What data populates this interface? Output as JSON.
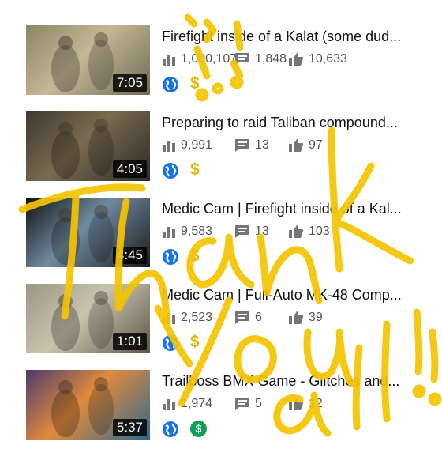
{
  "videos": [
    {
      "title": "Firefight inside of a Kalat (some dud...",
      "duration": "7:05",
      "views": "1,000,107",
      "comments": "1,848",
      "likes": "10,633",
      "monetization": "yellow",
      "thumb_colors": [
        "#8a8566",
        "#c4b896",
        "#6e6b55"
      ]
    },
    {
      "title": "Preparing to raid Taliban compound...",
      "duration": "4:05",
      "views": "9,991",
      "comments": "13",
      "likes": "97",
      "monetization": "yellow",
      "thumb_colors": [
        "#3c3a30",
        "#7a6a50",
        "#2a2a26"
      ]
    },
    {
      "title": "Medic Cam | Firefight inside of a Kal...",
      "duration": "4:45",
      "views": "9,583",
      "comments": "13",
      "likes": "103",
      "monetization": "yellow",
      "thumb_colors": [
        "#111111",
        "#6f8aa0",
        "#1a1a1a"
      ]
    },
    {
      "title": "Medic Cam | Full-Auto MK-48 Comp...",
      "duration": "1:01",
      "views": "2,523",
      "comments": "6",
      "likes": "39",
      "monetization": "yellow",
      "thumb_colors": [
        "#9c9684",
        "#c9c3ae",
        "#5a5648"
      ]
    },
    {
      "title": "Trailboss BMX Game - Glitches and...",
      "duration": "5:37",
      "views": "1,974",
      "comments": "5",
      "likes": "12",
      "monetization": "green",
      "thumb_colors": [
        "#4b3b6b",
        "#e08a3c",
        "#2f6a8f"
      ]
    }
  ],
  "icons": {
    "views": "bar-chart-icon",
    "comments": "comment-icon",
    "likes": "thumbs-up-icon",
    "visibility": "globe-icon",
    "money": "dollar-icon"
  },
  "colors": {
    "accent": "#f5c400",
    "globe": "#1a73e8",
    "money_yellow": "#e0b800",
    "money_green": "#0f9d58",
    "icon_gray": "#757575"
  }
}
